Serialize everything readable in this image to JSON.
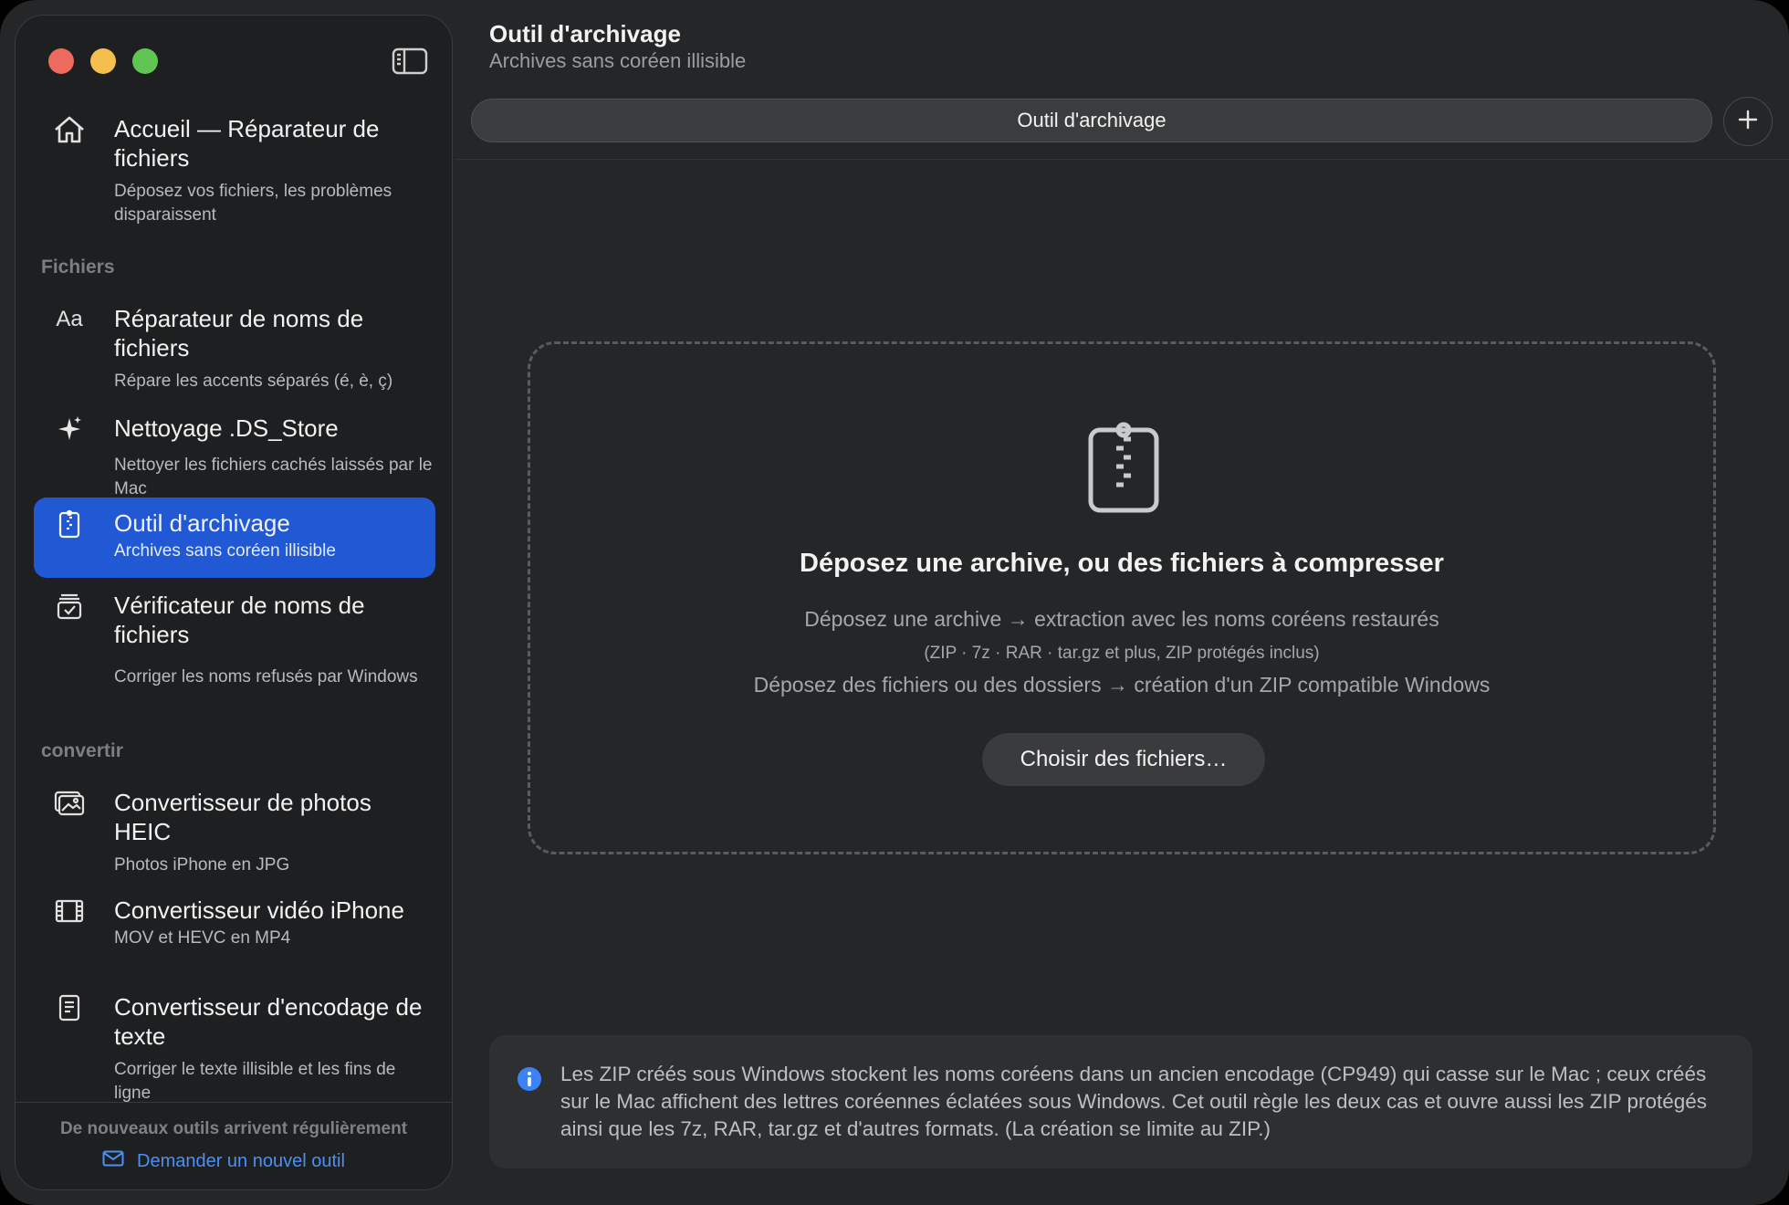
{
  "window": {
    "title": "Outil d'archivage",
    "subtitle": "Archives sans coréen illisible"
  },
  "sidebar": {
    "home": {
      "title": "Accueil — Réparateur de fichiers",
      "subtitle": "Déposez vos fichiers, les problèmes disparaissent",
      "icon": "house-icon"
    },
    "section_files": "Fichiers",
    "items_files": [
      {
        "title": "Réparateur de noms de fichiers",
        "subtitle": "Répare les accents séparés (é, è, ç)",
        "icon": "text-aa-icon"
      },
      {
        "title": "Nettoyage .DS_Store",
        "subtitle": "Nettoyer les fichiers cachés laissés par le Mac",
        "icon": "sparkles-icon"
      },
      {
        "title": "Outil d'archivage",
        "subtitle": "Archives sans coréen illisible",
        "icon": "archive-zipper-icon",
        "active": true
      },
      {
        "title": "Vérificateur de noms de fichiers",
        "subtitle": "Corriger les noms refusés par Windows",
        "icon": "checklist-tray-icon"
      }
    ],
    "section_convert": "convertir",
    "items_convert": [
      {
        "title": "Convertisseur de photos HEIC",
        "subtitle": "Photos iPhone en JPG",
        "icon": "photos-icon"
      },
      {
        "title": "Convertisseur vidéo iPhone",
        "subtitle": "MOV et HEVC en MP4",
        "icon": "film-icon"
      },
      {
        "title": "Convertisseur d'encodage de texte",
        "subtitle": "Corriger le texte illisible et les fins de ligne",
        "icon": "document-text-icon"
      }
    ],
    "footer_text": "De nouveaux outils arrivent régulièrement",
    "footer_link": "Demander un nouvel outil"
  },
  "tabs": [
    {
      "label": "Outil d'archivage"
    }
  ],
  "dropzone": {
    "heading": "Déposez une archive, ou des fichiers à compresser",
    "line1": "Déposez une archive → extraction avec les noms coréens restaurés",
    "line2": "(ZIP · 7z · RAR · tar.gz et plus, ZIP protégés inclus)",
    "line3": "Déposez des fichiers ou des dossiers → création d'un ZIP compatible Windows",
    "button": "Choisir des fichiers…"
  },
  "info": {
    "text": "Les ZIP créés sous Windows stockent les noms coréens dans un ancien encodage (CP949) qui casse sur le Mac ; ceux créés sur le Mac affichent des lettres coréennes éclatées sous Windows. Cet outil règle les deux cas et ouvre aussi les ZIP protégés ainsi que les 7z, RAR, tar.gz et d'autres formats. (La création se limite au ZIP.)"
  },
  "colors": {
    "accent": "#2159d4",
    "link": "#4a90f5",
    "info_icon": "#3b82f6"
  }
}
